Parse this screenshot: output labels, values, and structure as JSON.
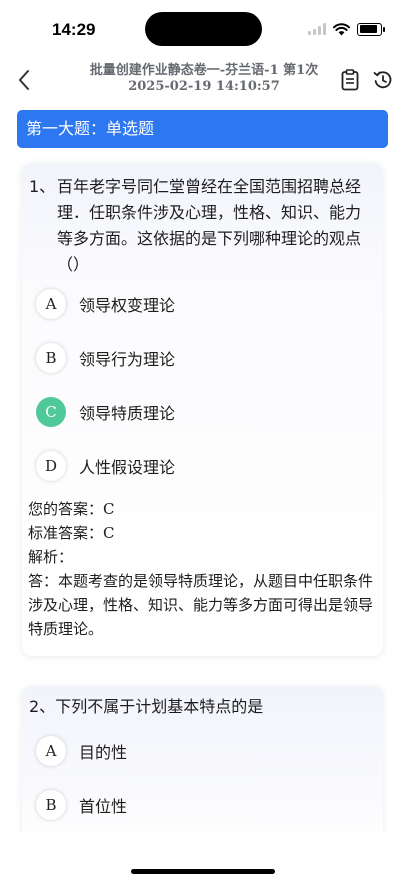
{
  "status": {
    "time": "14:29"
  },
  "nav": {
    "title": "批量创建作业静态卷一-芬兰语-1 第1次 2025-02-19 14:10:57",
    "icons": [
      "back-chevron-icon",
      "clipboard-icon",
      "history-icon"
    ]
  },
  "section": {
    "title": "第一大题：单选题"
  },
  "questions": [
    {
      "number": "1、",
      "stem": "百年老字号同仁堂曾经在全国范围招聘总经理．任职条件涉及心理，性格、知识、能力等多方面。这依据的是下列哪种理论的观点（）",
      "options": [
        {
          "letter": "A",
          "text": "领导权变理论"
        },
        {
          "letter": "B",
          "text": "领导行为理论"
        },
        {
          "letter": "C",
          "text": "领导特质理论"
        },
        {
          "letter": "D",
          "text": "人性假设理论"
        }
      ],
      "selected": "C",
      "your_answer_label": "您的答案：",
      "your_answer": "C",
      "standard_answer_label": "标准答案：",
      "standard_answer": "C",
      "analysis_label": "解析：",
      "analysis": "答：本题考查的是领导特质理论，从题目中任职条件涉及心理，性格、知识、能力等多方面可得出是领导特质理论。"
    },
    {
      "number": "2、",
      "stem": "下列不属于计划基本特点的是",
      "options": [
        {
          "letter": "A",
          "text": "目的性"
        },
        {
          "letter": "B",
          "text": "首位性"
        }
      ]
    }
  ],
  "colors": {
    "section_bg": "#2d77f0",
    "selected_option": "#4fc99a"
  }
}
